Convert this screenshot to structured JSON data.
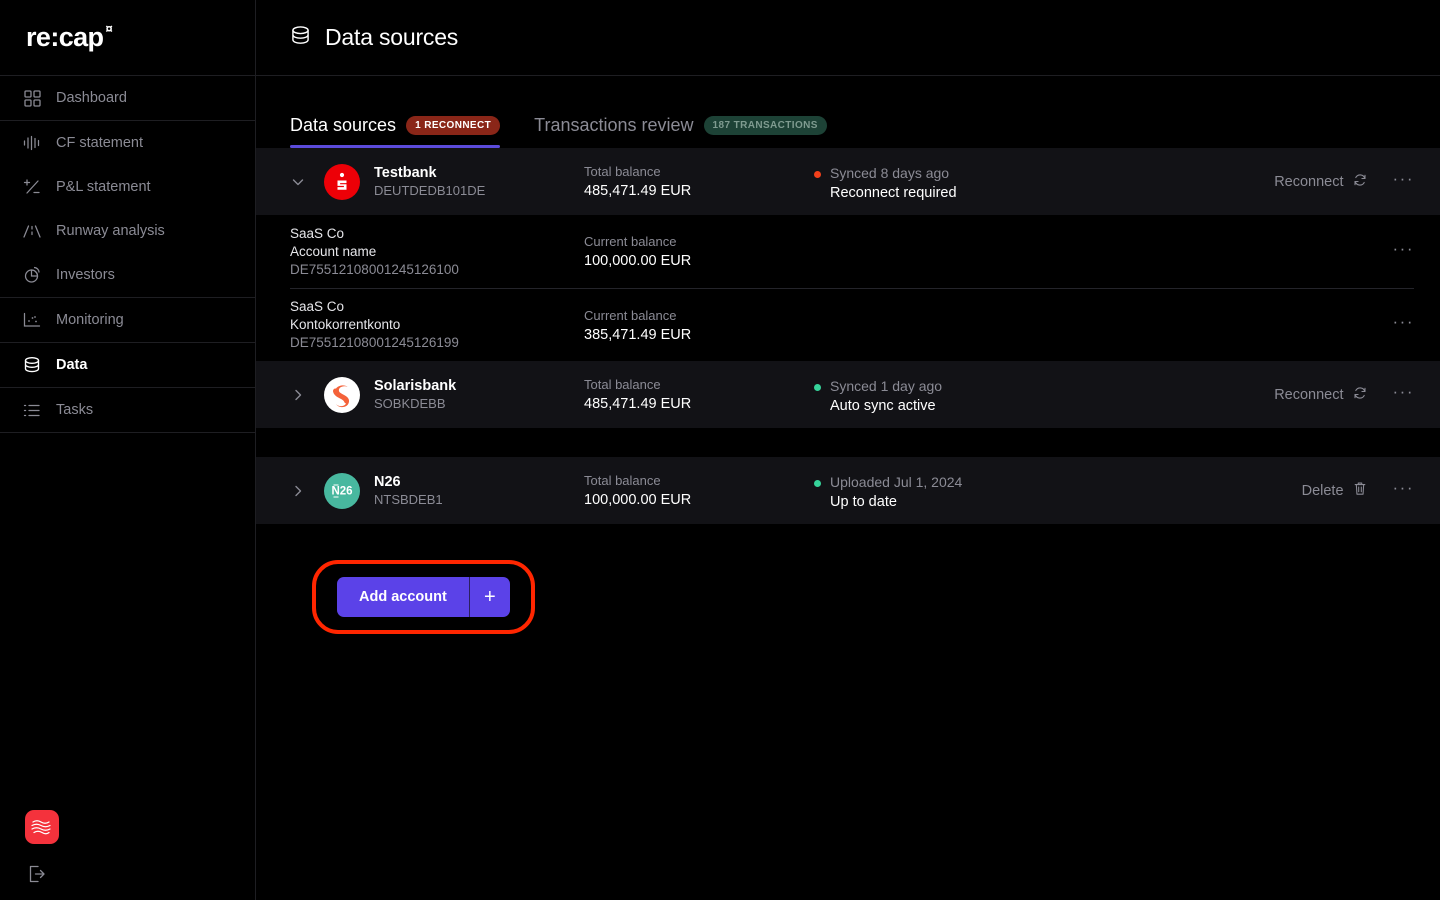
{
  "brand": {
    "name": "re:cap",
    "mark": "¤"
  },
  "sidebar": {
    "groups": [
      {
        "items": [
          {
            "label": "Dashboard",
            "icon": "dashboard-icon",
            "active": false
          }
        ]
      },
      {
        "items": [
          {
            "label": "CF statement",
            "icon": "cf-statement-icon",
            "active": false
          },
          {
            "label": "P&L statement",
            "icon": "pl-statement-icon",
            "active": false
          },
          {
            "label": "Runway analysis",
            "icon": "runway-icon",
            "active": false
          },
          {
            "label": "Investors",
            "icon": "investors-icon",
            "active": false
          }
        ]
      },
      {
        "items": [
          {
            "label": "Monitoring",
            "icon": "monitoring-icon",
            "active": false
          }
        ]
      },
      {
        "items": [
          {
            "label": "Data",
            "icon": "data-icon",
            "active": true
          }
        ]
      },
      {
        "items": [
          {
            "label": "Tasks",
            "icon": "tasks-icon",
            "active": false
          }
        ]
      }
    ],
    "bottom": {
      "avatar": "recap-avatar",
      "logout": "logout-icon"
    }
  },
  "header": {
    "title": "Data sources",
    "icon": "database-icon"
  },
  "tabs": [
    {
      "label": "Data sources",
      "badge": "1 RECONNECT",
      "badge_color": "red",
      "active": true
    },
    {
      "label": "Transactions review",
      "badge": "187 TRANSACTIONS",
      "badge_color": "green",
      "active": false
    }
  ],
  "labels": {
    "total_balance": "Total balance",
    "current_balance": "Current balance",
    "reconnect": "Reconnect",
    "delete": "Delete",
    "kebab": "···"
  },
  "banks": [
    {
      "name": "Testbank",
      "bic": "DEUTDEDB101DE",
      "logo": "testbank-logo",
      "expanded": true,
      "balance_label": "Total balance",
      "balance_value": "485,471.49 EUR",
      "status_dot": "red",
      "status_top": "Synced 8 days ago",
      "status_bottom": "Reconnect required",
      "action_label": "Reconnect",
      "action_icon": "refresh-icon",
      "accounts": [
        {
          "company": "SaaS Co",
          "name": "Account name",
          "iban": "DE75512108001245126100",
          "balance_label": "Current balance",
          "balance_value": "100,000.00 EUR"
        },
        {
          "company": "SaaS Co",
          "name": "Kontokorrentkonto",
          "iban": "DE75512108001245126199",
          "balance_label": "Current balance",
          "balance_value": "385,471.49 EUR"
        }
      ]
    },
    {
      "name": "Solarisbank",
      "bic": "SOBKDEBB",
      "logo": "solarisbank-logo",
      "expanded": false,
      "balance_label": "Total balance",
      "balance_value": "485,471.49 EUR",
      "status_dot": "green",
      "status_top": "Synced 1 day ago",
      "status_bottom": "Auto sync active",
      "action_label": "Reconnect",
      "action_icon": "refresh-icon",
      "accounts": []
    },
    {
      "name": "N26",
      "bic": "NTSBDEB1",
      "logo": "n26-logo",
      "expanded": false,
      "balance_label": "Total balance",
      "balance_value": "100,000.00 EUR",
      "status_dot": "green",
      "status_top": "Uploaded Jul 1, 2024",
      "status_bottom": "Up to date",
      "action_label": "Delete",
      "action_icon": "trash-icon",
      "accounts": []
    }
  ],
  "add_account": {
    "label": "Add account",
    "plus": "+",
    "highlighted": true
  },
  "colors": {
    "accent": "#5b42e8",
    "highlight_ring": "#ff2600",
    "status_red": "#f2401b",
    "status_green": "#36d39a",
    "badge_red_bg": "#8a2618",
    "badge_green_bg": "#1d4236",
    "row_bg": "#121216",
    "page_bg": "#000000"
  }
}
